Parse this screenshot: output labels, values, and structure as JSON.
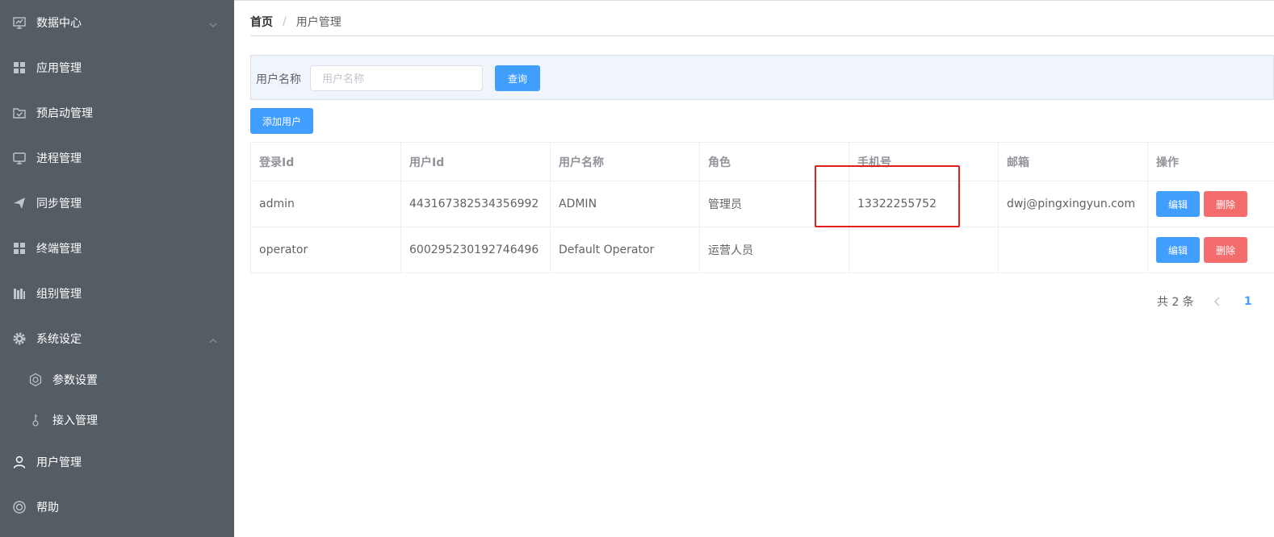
{
  "sidebar": {
    "items": [
      {
        "label": "数据中心",
        "icon": "monitor-chart-icon",
        "arrow": "chevron-down"
      },
      {
        "label": "应用管理",
        "icon": "grid-icon"
      },
      {
        "label": "预启动管理",
        "icon": "folder-check-icon"
      },
      {
        "label": "进程管理",
        "icon": "monitor-icon"
      },
      {
        "label": "同步管理",
        "icon": "send-icon"
      },
      {
        "label": "终端管理",
        "icon": "grid-icon"
      },
      {
        "label": "组别管理",
        "icon": "books-icon"
      },
      {
        "label": "系统设定",
        "icon": "gear-icon",
        "arrow": "chevron-up"
      },
      {
        "label": "参数设置",
        "icon": "gear-outline-icon"
      },
      {
        "label": "接入管理",
        "icon": "key-icon"
      },
      {
        "label": "用户管理",
        "icon": "user-icon"
      },
      {
        "label": "帮助",
        "icon": "lifebuoy-icon"
      }
    ]
  },
  "breadcrumb": {
    "home": "首页",
    "separator": "/",
    "current": "用户管理"
  },
  "filter": {
    "label": "用户名称",
    "placeholder": "用户名称",
    "query_label": "查询"
  },
  "toolbar": {
    "add_label": "添加用户"
  },
  "table": {
    "headers": [
      "登录Id",
      "用户Id",
      "用户名称",
      "角色",
      "手机号",
      "邮箱",
      "操作"
    ],
    "rows": [
      {
        "login_id": "admin",
        "user_id": "443167382534356992",
        "name": "ADMIN",
        "role": "管理员",
        "phone": "13322255752",
        "email": "dwj@pingxingyun.com"
      },
      {
        "login_id": "operator",
        "user_id": "600295230192746496",
        "name": "Default Operator",
        "role": "运营人员",
        "phone": "",
        "email": ""
      }
    ],
    "edit_label": "编辑",
    "delete_label": "删除"
  },
  "pagination": {
    "total_text": "共 2 条",
    "current_page": "1"
  },
  "colors": {
    "sidebar_bg": "#545c64",
    "primary": "#409eff",
    "danger": "#f56c6c",
    "highlight": "#e0201c"
  }
}
